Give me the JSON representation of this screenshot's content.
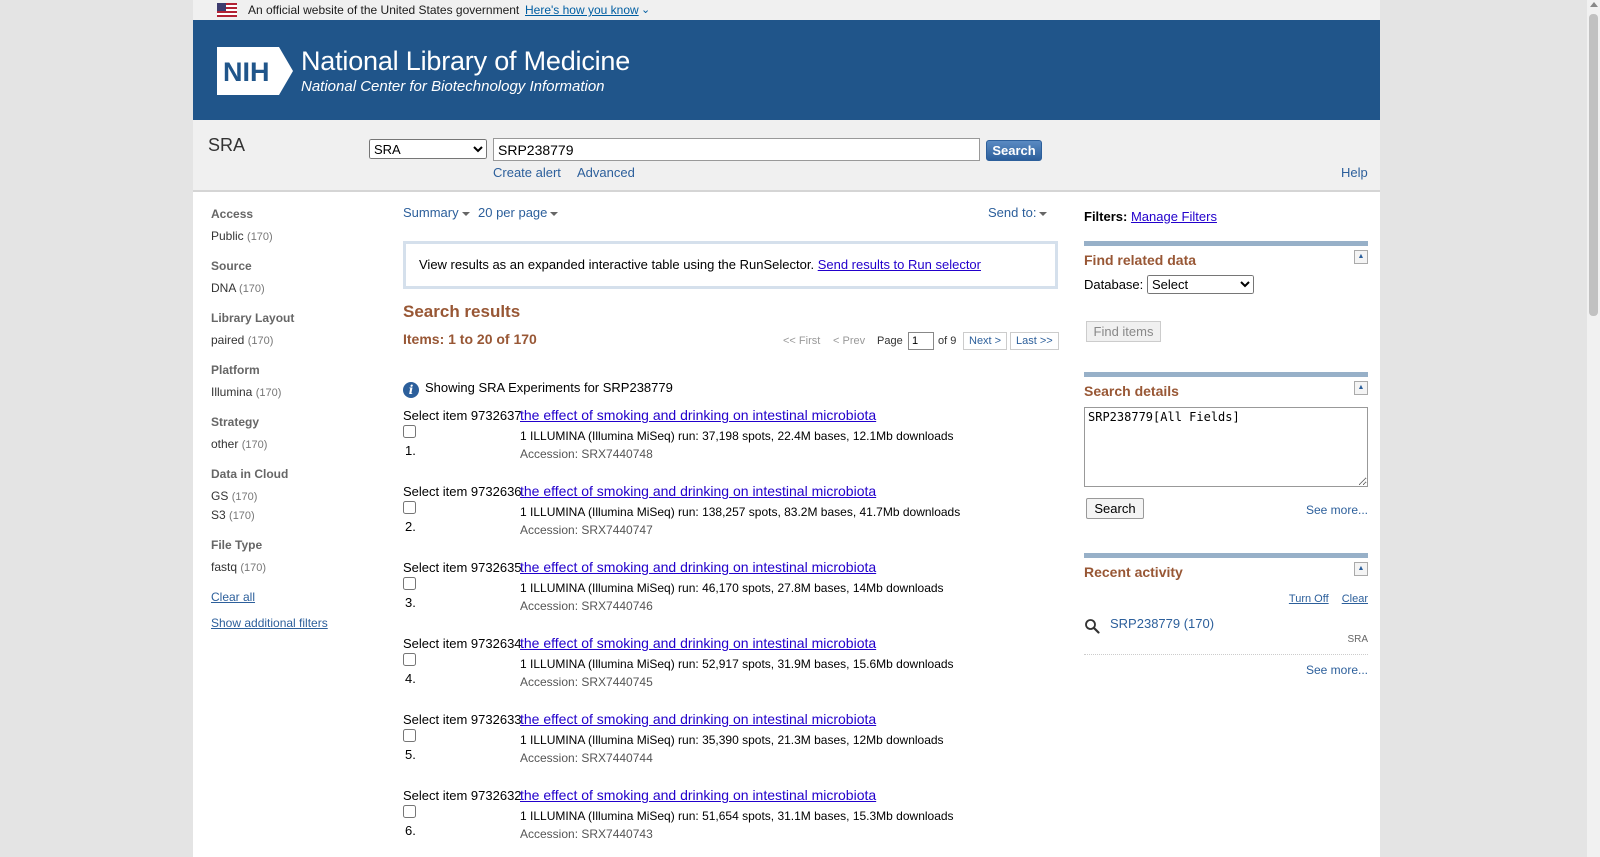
{
  "gov_banner": {
    "text": "An official website of the United States government",
    "how_link": "Here's how you know",
    "chevron": "⌄"
  },
  "header": {
    "logo_text": "NIH",
    "title": "National Library of Medicine",
    "subtitle": "National Center for Biotechnology Information"
  },
  "search": {
    "db_name": "SRA",
    "db_options": [
      "SRA"
    ],
    "db_selected": "SRA",
    "term": "SRP238779",
    "button": "Search",
    "create_alert": "Create alert",
    "advanced": "Advanced",
    "help": "Help"
  },
  "facets": [
    {
      "head": "Access",
      "items": [
        {
          "label": "Public",
          "count": "(170)"
        }
      ]
    },
    {
      "head": "Source",
      "items": [
        {
          "label": "DNA",
          "count": "(170)"
        }
      ]
    },
    {
      "head": "Library Layout",
      "items": [
        {
          "label": "paired",
          "count": "(170)"
        }
      ]
    },
    {
      "head": "Platform",
      "items": [
        {
          "label": "Illumina",
          "count": "(170)"
        }
      ]
    },
    {
      "head": "Strategy",
      "items": [
        {
          "label": "other",
          "count": "(170)"
        }
      ]
    },
    {
      "head": "Data in Cloud",
      "items": [
        {
          "label": "GS",
          "count": "(170)"
        },
        {
          "label": "S3",
          "count": "(170)"
        }
      ]
    },
    {
      "head": "File Type",
      "items": [
        {
          "label": "fastq",
          "count": "(170)"
        }
      ]
    }
  ],
  "facet_links": {
    "clear_all": "Clear all",
    "additional": "Show additional filters"
  },
  "toolbar": {
    "summary": "Summary",
    "per_page": "20 per page",
    "send_to": "Send to:"
  },
  "runselector": {
    "text": "View results as an expanded interactive table using the RunSelector.",
    "link": "Send results to Run selector"
  },
  "results_header": {
    "title": "Search results",
    "items": "Items: 1 to 20 of 170"
  },
  "pager": {
    "first": "<< First",
    "prev": "< Prev",
    "page_label": "Page",
    "page_value": "1",
    "of": "of 9",
    "next": "Next >",
    "last": "Last >>"
  },
  "showing": {
    "info_glyph": "i",
    "text": "Showing SRA Experiments for SRP238779"
  },
  "results": [
    {
      "select": "Select item 9732637",
      "num": "1.",
      "title": "the effect of smoking and drinking on intestinal microbiota",
      "desc": "1 ILLUMINA (Illumina MiSeq) run: 37,198 spots, 22.4M bases, 12.1Mb downloads",
      "acc": "Accession: SRX7440748"
    },
    {
      "select": "Select item 9732636",
      "num": "2.",
      "title": "the effect of smoking and drinking on intestinal microbiota",
      "desc": "1 ILLUMINA (Illumina MiSeq) run: 138,257 spots, 83.2M bases, 41.7Mb downloads",
      "acc": "Accession: SRX7440747"
    },
    {
      "select": "Select item 9732635",
      "num": "3.",
      "title": "the effect of smoking and drinking on intestinal microbiota",
      "desc": "1 ILLUMINA (Illumina MiSeq) run: 46,170 spots, 27.8M bases, 14Mb downloads",
      "acc": "Accession: SRX7440746"
    },
    {
      "select": "Select item 9732634",
      "num": "4.",
      "title": "the effect of smoking and drinking on intestinal microbiota",
      "desc": "1 ILLUMINA (Illumina MiSeq) run: 52,917 spots, 31.9M bases, 15.6Mb downloads",
      "acc": "Accession: SRX7440745"
    },
    {
      "select": "Select item 9732633",
      "num": "5.",
      "title": "the effect of smoking and drinking on intestinal microbiota",
      "desc": "1 ILLUMINA (Illumina MiSeq) run: 35,390 spots, 21.3M bases, 12Mb downloads",
      "acc": "Accession: SRX7440744"
    },
    {
      "select": "Select item 9732632",
      "num": "6.",
      "title": "the effect of smoking and drinking on intestinal microbiota",
      "desc": "1 ILLUMINA (Illumina MiSeq) run: 51,654 spots, 31.1M bases, 15.3Mb downloads",
      "acc": "Accession: SRX7440743"
    }
  ],
  "right": {
    "filters_label": "Filters:",
    "manage_filters": "Manage Filters",
    "find_related": {
      "title": "Find related data",
      "db_label": "Database:",
      "db_selected": "Select",
      "button": "Find items"
    },
    "search_details": {
      "title": "Search details",
      "query": "SRP238779[All Fields]",
      "button": "Search",
      "see_more": "See more..."
    },
    "recent": {
      "title": "Recent activity",
      "turn_off": "Turn Off",
      "clear": "Clear",
      "item": "SRP238779 (170)",
      "item_db": "SRA",
      "see_more": "See more..."
    }
  },
  "colors": {
    "header_bg": "#20558a",
    "section_title": "#985735",
    "link": "#2200cc"
  }
}
